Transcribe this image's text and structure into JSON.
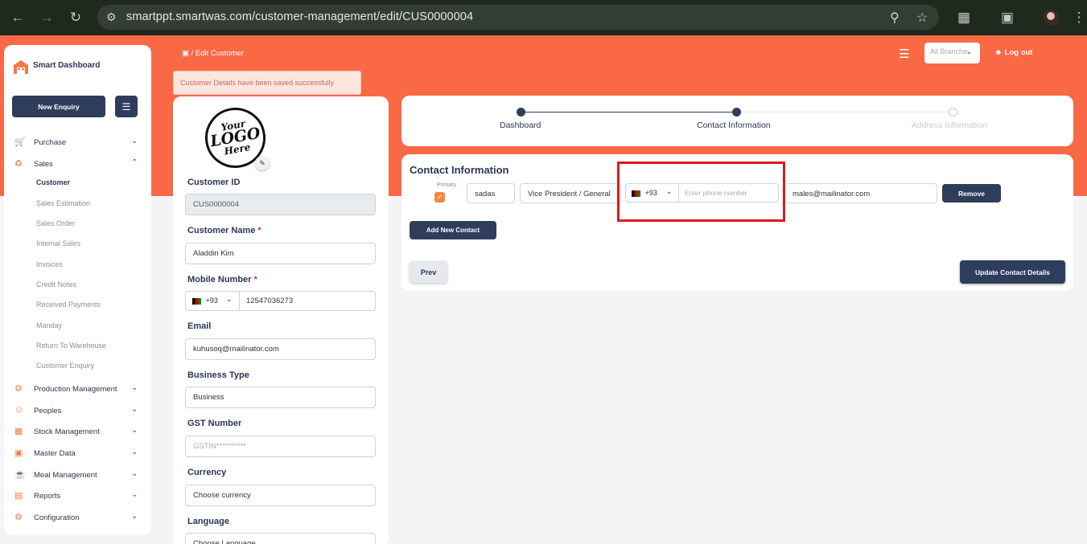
{
  "browser": {
    "url": "smartppt.smartwas.com/customer-management/edit/CUS0000004",
    "icons": [
      "back-arrow-icon",
      "forward-arrow-icon",
      "reload-icon",
      "site-info-icon",
      "zoom-icon",
      "bookmark-star-icon",
      "extensions-icon",
      "cast-icon",
      "profile-avatar",
      "kebab-menu-icon"
    ]
  },
  "sidebar": {
    "brand": "Smart Dashboard",
    "new_enquiry": "New Enquiry",
    "items": [
      {
        "label": "Purchase"
      },
      {
        "label": "Sales"
      },
      {
        "label": "Production Management"
      },
      {
        "label": "Peoples"
      },
      {
        "label": "Stock Management"
      },
      {
        "label": "Master Data"
      },
      {
        "label": "Meal Management"
      },
      {
        "label": "Reports"
      },
      {
        "label": "Configuration"
      }
    ],
    "sales_sub": [
      "Customer",
      "Sales Estimation",
      "Sales Order",
      "Internal Sales",
      "Invoices",
      "Credit Notes",
      "Received Payments",
      "Manday",
      "Return To Warehouse",
      "Customer Enquiry"
    ]
  },
  "header": {
    "breadcrumb_sep": "/",
    "breadcrumb": "Edit Customer",
    "branch": "All Branches",
    "logout": "Log out"
  },
  "toast": "Customer Details have been saved successfully",
  "form": {
    "logo_lines": [
      "Your",
      "LOGO",
      "Here"
    ],
    "customer_id_label": "Customer ID",
    "customer_id": "CUS0000004",
    "customer_name_label": "Customer Name",
    "customer_name": "Aladdin Kim",
    "mobile_label": "Mobile Number",
    "mobile_code": "+93",
    "mobile_number": "12547036273",
    "email_label": "Email",
    "email": "kuhusoq@mailinator.com",
    "business_type_label": "Business Type",
    "business_type": "Business",
    "gst_label": "GST Number",
    "gst_placeholder": "GSTIN**********",
    "currency_label": "Currency",
    "currency": "Choose currency",
    "language_label": "Language",
    "language": "Choose Language",
    "required_mark": "*"
  },
  "stepper": {
    "steps": [
      "Dashboard",
      "Contact Information",
      "Address Information"
    ],
    "active_index": 1
  },
  "contact": {
    "title": "Contact Information",
    "primary_label": "Primary",
    "primary_checked": true,
    "name": "sadas",
    "designation": "Vice President / General",
    "phone_code": "+93",
    "phone_placeholder": "Enter phone number",
    "email": "males@mailinator.com",
    "remove": "Remove",
    "add_new": "Add New Contact",
    "prev": "Prev",
    "update": "Update Contact Details"
  },
  "colors": {
    "brand_orange": "#f96946",
    "navy": "#2f3d5c",
    "highlight_red": "#d91b1b"
  }
}
